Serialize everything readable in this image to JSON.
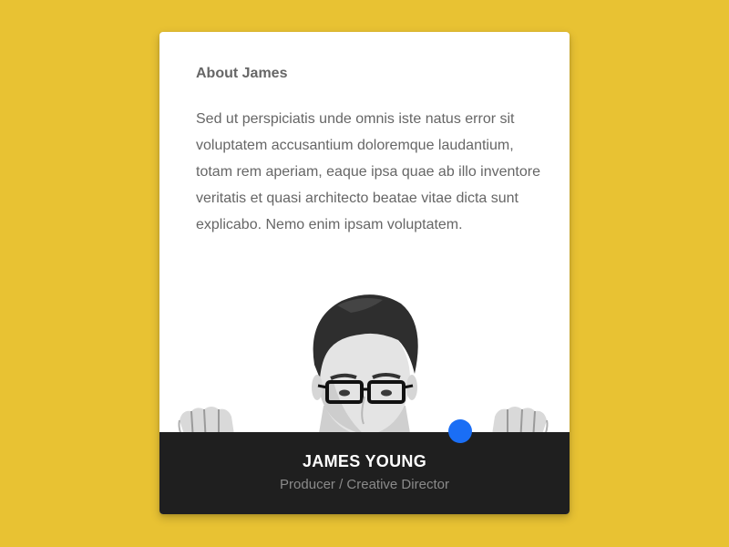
{
  "profile": {
    "heading": "About James",
    "bio": "Sed ut perspiciatis unde omnis iste natus error sit voluptatem accusantium doloremque laudantium, totam rem aperiam, eaque ipsa quae ab illo inventore veritatis et quasi architecto beatae vitae dicta sunt explicabo. Nemo enim ipsam voluptatem.",
    "name": "JAMES YOUNG",
    "role": "Producer / Creative Director"
  },
  "colors": {
    "background": "#e8c233",
    "card": "#ffffff",
    "footer": "#1f1f1f",
    "status_dot": "#1a6ef5",
    "body_text": "#666666",
    "role_text": "#8a8a8a"
  },
  "icons": {
    "portrait": "person-photo",
    "left_hand": "hand-icon",
    "right_hand": "hand-icon",
    "status": "online-status-dot"
  }
}
